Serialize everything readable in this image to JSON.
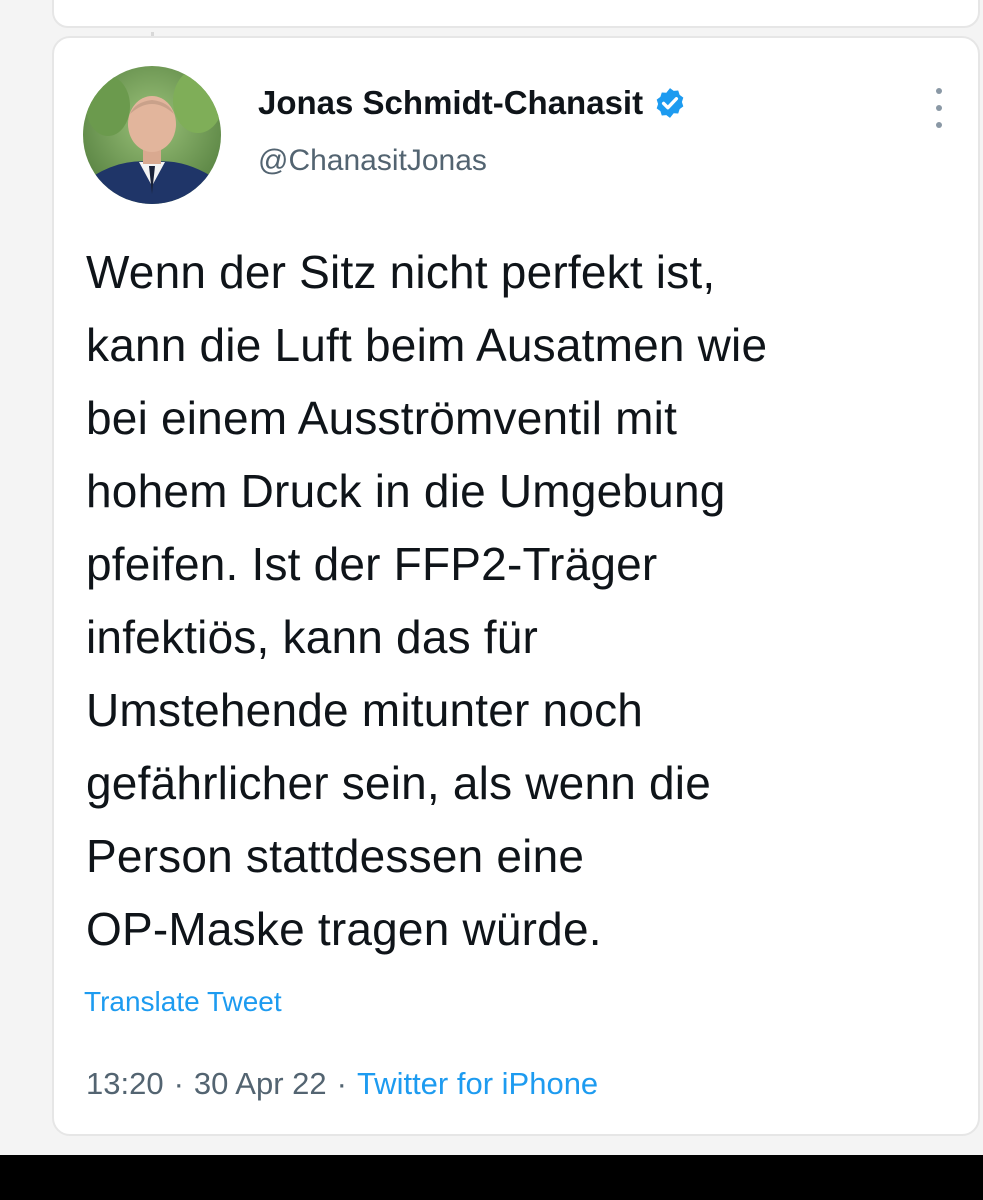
{
  "tweet": {
    "author": {
      "display_name": "Jonas Schmidt-Chanasit",
      "handle": "@ChanasitJonas",
      "verified": true
    },
    "text": "Wenn der Sitz nicht perfekt ist,\nkann die Luft beim Ausatmen wie\nbei einem Ausströmventil mit\nhohem Druck in die Umgebung\npfeifen. Ist der FFP2-Träger\ninfektiös, kann das für\nUmstehende mitunter noch\ngefährlicher sein, als wenn die\nPerson stattdessen eine\nOP-Maske tragen würde.",
    "translate_label": "Translate Tweet",
    "time": "13:20",
    "separator": "·",
    "date": "30 Apr 22",
    "source": "Twitter for iPhone"
  },
  "icons": {
    "verified": "verified-badge-icon",
    "more": "more-options-icon"
  },
  "colors": {
    "link": "#1d9bf0",
    "secondary_text": "#536471",
    "primary_text": "#0f1419"
  }
}
